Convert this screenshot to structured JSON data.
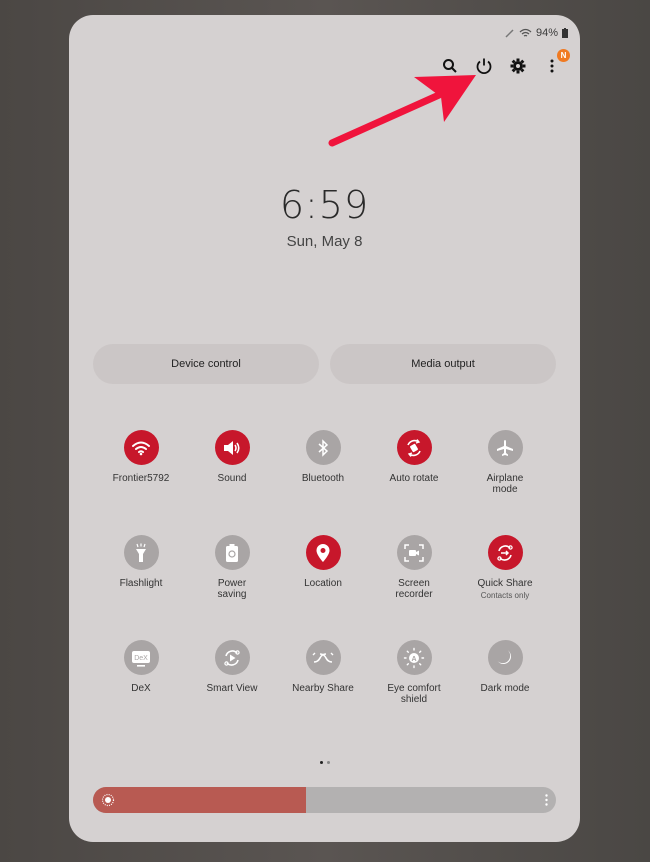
{
  "status_bar": {
    "battery_percent": "94%",
    "icons": [
      "pen-icon",
      "wifi-icon",
      "battery-icon"
    ]
  },
  "top_actions": {
    "icons": [
      "search-icon",
      "power-icon",
      "settings-icon",
      "more-icon"
    ],
    "notification_badge": "N"
  },
  "annotation": {
    "type": "arrow",
    "color": "#f0143c",
    "points_to": "power-icon"
  },
  "clock": {
    "time": "6:59",
    "date": "Sun, May 8"
  },
  "buttons": {
    "device_control": "Device control",
    "media_output": "Media output"
  },
  "tiles": [
    {
      "label": "Frontier5792",
      "icon": "wifi-icon",
      "active": true
    },
    {
      "label": "Sound",
      "icon": "sound-icon",
      "active": true
    },
    {
      "label": "Bluetooth",
      "icon": "bluetooth-icon",
      "active": false
    },
    {
      "label": "Auto rotate",
      "icon": "auto-rotate-icon",
      "active": true
    },
    {
      "label": "Airplane mode",
      "icon": "airplane-icon",
      "active": false
    },
    {
      "label": "Flashlight",
      "icon": "flashlight-icon",
      "active": false
    },
    {
      "label": "Power saving",
      "icon": "power-saving-icon",
      "active": false
    },
    {
      "label": "Location",
      "icon": "location-icon",
      "active": true
    },
    {
      "label": "Screen recorder",
      "icon": "screen-recorder-icon",
      "active": false
    },
    {
      "label": "Quick Share",
      "sublabel": "Contacts only",
      "icon": "quick-share-icon",
      "active": true
    },
    {
      "label": "DeX",
      "icon": "dex-icon",
      "active": false
    },
    {
      "label": "Smart View",
      "icon": "smart-view-icon",
      "active": false
    },
    {
      "label": "Nearby Share",
      "icon": "nearby-share-icon",
      "active": false
    },
    {
      "label": "Eye comfort shield",
      "icon": "eye-comfort-icon",
      "active": false
    },
    {
      "label": "Dark mode",
      "icon": "dark-mode-icon",
      "active": false
    }
  ],
  "pager": {
    "pages": 2,
    "current": 1
  },
  "brightness": {
    "level_percent": 46,
    "icon": "sun-icon"
  },
  "colors": {
    "active_tile": "#c7172b",
    "inactive_tile": "#a9a5a5",
    "brightness_fill": "#b85a52"
  }
}
